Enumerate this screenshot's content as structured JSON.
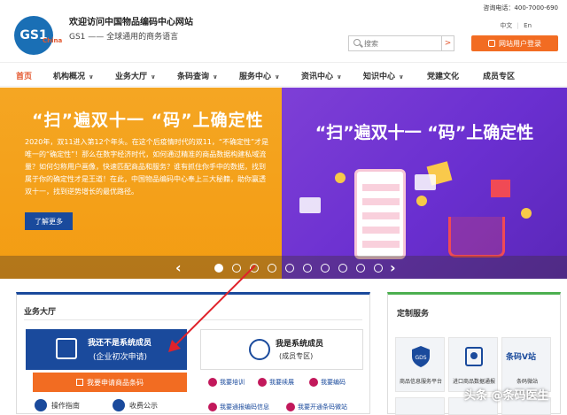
{
  "header": {
    "logo_text": "GS1",
    "logo_sub": "China",
    "title": "欢迎访问中国物品编码中心网站",
    "subtitle": "GS1 —— 全球通用的商务语言",
    "hotline": "咨询电话：400-7000-690",
    "lang_cn": "中文",
    "lang_en": "En",
    "search_placeholder": "搜索",
    "search_button": ">",
    "login_label": "网站用户登录"
  },
  "nav": {
    "items": [
      {
        "label": "首页",
        "chevron": ""
      },
      {
        "label": "机构概况",
        "chevron": "∨"
      },
      {
        "label": "业务大厅",
        "chevron": "∨"
      },
      {
        "label": "条码查询",
        "chevron": "∨"
      },
      {
        "label": "服务中心",
        "chevron": "∨"
      },
      {
        "label": "资讯中心",
        "chevron": "∨"
      },
      {
        "label": "知识中心",
        "chevron": "∨"
      },
      {
        "label": "党建文化",
        "chevron": ""
      },
      {
        "label": "成员专区",
        "chevron": ""
      }
    ]
  },
  "banner": {
    "left_title": "“扫”遍双十一 “码”上确定性",
    "left_text": "2020年，双11进入第12个年头。在这个后疫情时代的双11，“不确定性”才是唯一的“确定性”！那么在数字经济时代，如何通过精准的商品数据构建私域流量？如何匀称用户画像，快速匹配商品和服务？谁有抓住你手中的数据，找到属于你的确定性才是王道！在此，中国物品编码中心奉上三大秘籍，助你赢透双十一，找到逆势增长的最优路径。",
    "more_label": "了解更多",
    "right_title": "“扫”遍双十一 “码”上确定性",
    "prev_arrow": "‹",
    "next_arrow": "›",
    "dot_count": 10,
    "active_dot": 0
  },
  "business_hall": {
    "title": "业务大厅",
    "card_new": {
      "line1": "我还不是系统成员",
      "line2": "(企业初次申请)"
    },
    "card_member": {
      "line1": "我是系统成员",
      "line2": "(成员专区)"
    },
    "apply_button": "我要申请商品条码",
    "links_left": [
      "操作指南",
      "收费公示"
    ],
    "links_right_row1": [
      "我要培训",
      "我要续展",
      "我要编码"
    ],
    "links_right_row2": [
      "我要通报编码信息",
      "我要开通条码微站"
    ]
  },
  "custom_service": {
    "title": "定制服务",
    "items": [
      {
        "label": "商品信息服务平台",
        "icon": "gds-shield-icon"
      },
      {
        "label": "进口商品数据通报",
        "icon": "import-data-icon"
      },
      {
        "label": "条码微站",
        "icon": "barcode-v-site-icon",
        "logo_text": "条码V站"
      }
    ]
  },
  "watermark": "头条 @条码医生",
  "colors": {
    "brand_orange": "#f26c22",
    "brand_blue": "#1a4a9c",
    "banner_left": "#f5a623",
    "banner_right": "#6a2fd0",
    "accent_green": "#4caf50"
  }
}
